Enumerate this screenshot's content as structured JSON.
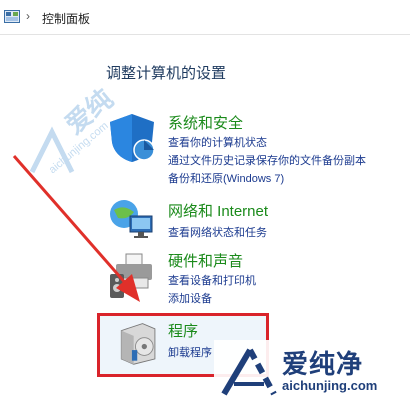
{
  "address_bar": {
    "crumb": "控制面板",
    "chevron": "›"
  },
  "heading": "调整计算机的设置",
  "categories": [
    {
      "title": "系统和安全",
      "links": [
        "查看你的计算机状态",
        "通过文件历史记录保存你的文件备份副本",
        "备份和还原(Windows 7)"
      ]
    },
    {
      "title": "网络和 Internet",
      "links": [
        "查看网络状态和任务"
      ]
    },
    {
      "title": "硬件和声音",
      "links": [
        "查看设备和打印机",
        "添加设备"
      ]
    },
    {
      "title": "程序",
      "links": [
        "卸载程序"
      ]
    }
  ],
  "watermark": {
    "left_big": "爱纯",
    "left_small": "aichunjing.com",
    "logo_cn": "爱纯净",
    "logo_url": "aichunjing.com"
  },
  "colors": {
    "category_title": "#1a8a1a",
    "link": "#1b3a8f",
    "highlight": "#d9232a",
    "arrow": "#e0302a"
  }
}
